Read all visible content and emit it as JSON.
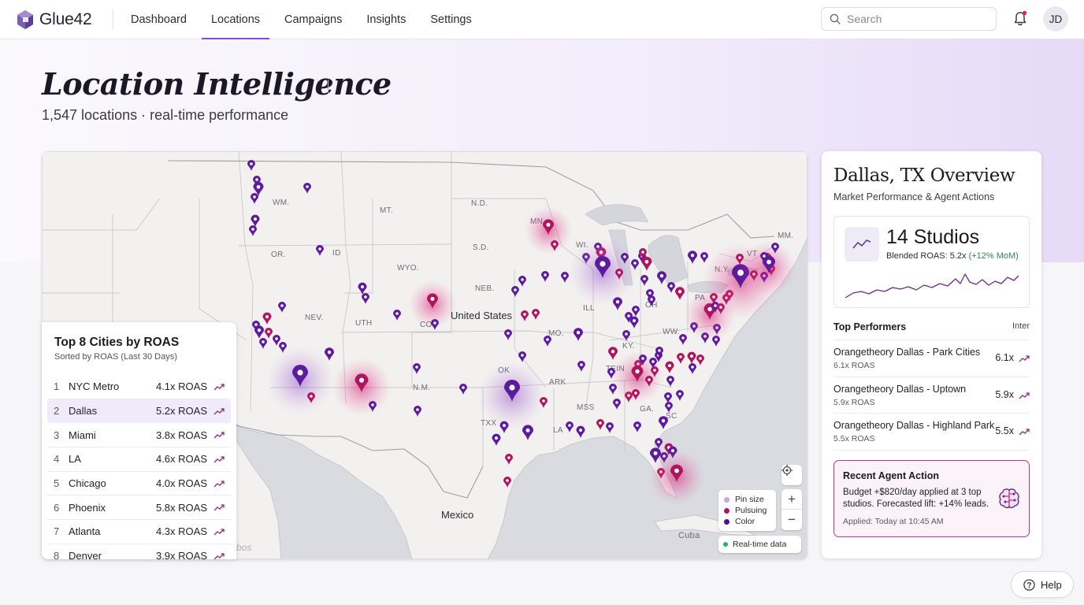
{
  "app": {
    "name": "Glue42"
  },
  "nav": {
    "items": [
      "Dashboard",
      "Locations",
      "Campaigns",
      "Insights",
      "Settings"
    ],
    "active": "Locations"
  },
  "search": {
    "placeholder": "Search"
  },
  "user": {
    "initials": "JD"
  },
  "header": {
    "title": "Location Intelligence",
    "subtitle": "1,547 locations · real-time performance"
  },
  "colors": {
    "accent": "#7a4fd0",
    "pin_purple": "#5e1a9c",
    "pin_magenta": "#b0145f",
    "agent_border": "#b33a83",
    "positive": "#2c8a4a"
  },
  "map": {
    "country_labels": {
      "us": "United States",
      "mexico": "Mexico",
      "cuba": "Cuba"
    },
    "state_labels": [
      "WM.",
      "MT.",
      "N.D.",
      "MN.",
      "WI.",
      "MM.",
      "OR.",
      "ID",
      "WYO.",
      "S.D.",
      "VT",
      "N.Y.",
      "PA",
      "NEB.",
      "ILL",
      "OH",
      "NEV.",
      "UTH",
      "COD",
      "MO.",
      "KY.",
      "WW.",
      "N.M.",
      "OK",
      "TEIN",
      "ARK",
      "MSS",
      "GA.",
      "TXX",
      "LA",
      "SC"
    ],
    "legend": {
      "pin_size": "Pin size",
      "pulsing": "Pulsuing",
      "color": "Color"
    },
    "realtime_label": "Real-time data",
    "attribution": "bos"
  },
  "top_cities": {
    "title": "Top 8 Cities by ROAS",
    "subtitle": "Sorted by ROAS (Last 30 Days)",
    "rows": [
      {
        "rank": "1",
        "city": "NYC Metro",
        "roas": "4.1x ROAS"
      },
      {
        "rank": "2",
        "city": "Dallas",
        "roas": "5.2x ROAS",
        "selected": true
      },
      {
        "rank": "3",
        "city": "Miami",
        "roas": "3.8x ROAS"
      },
      {
        "rank": "4",
        "city": "LA",
        "roas": "4.6x ROAS"
      },
      {
        "rank": "5",
        "city": "Chicago",
        "roas": "4.0x ROAS"
      },
      {
        "rank": "6",
        "city": "Phoenix",
        "roas": "5.8x ROAS"
      },
      {
        "rank": "7",
        "city": "Atlanta",
        "roas": "4.3x ROAS"
      },
      {
        "rank": "8",
        "city": "Denver",
        "roas": "3.9x ROAS"
      }
    ]
  },
  "overview": {
    "title": "Dallas, TX Overview",
    "subtitle": "Market Performance & Agent Actions",
    "studios": {
      "count": "14 Studios",
      "roas_label": "Blended ROAS: 5.2x ",
      "roas_delta": "(+12% MoM)"
    },
    "top_performers": {
      "title": "Top Performers",
      "interval": "Inter",
      "rows": [
        {
          "name": "Orangetheory Dallas - Park Cities",
          "sub": "6.1x ROAS",
          "value": "6.1x"
        },
        {
          "name": "Orangetheory Dallas - Uptown",
          "sub": "5.9x ROAS",
          "value": "5.9x"
        },
        {
          "name": "Orangetheory Dallas - Highland Park",
          "sub": "5.5x ROAS",
          "value": "5.5x"
        }
      ]
    },
    "agent": {
      "title": "Recent Agent Action",
      "text": "Budget +$820/day applied at 3 top studios. Forecasted lift: +14% leads.",
      "time": "Applied: Today at 10:45 AM"
    }
  },
  "help": {
    "label": "Help"
  }
}
